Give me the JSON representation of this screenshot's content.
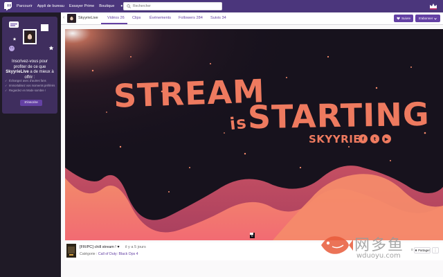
{
  "nav": {
    "items": [
      "Parcourir",
      "Appli de bureau",
      "Essayer Prime",
      "Boutique"
    ],
    "more": "•••",
    "search_placeholder": "Rechercher"
  },
  "sidebar": {
    "promo_line1": "Inscrivez-vous pour profiter de ce que",
    "promo_channel": "SkyyrieLive",
    "promo_line2": "a de mieux à offrir :",
    "benefits": [
      "Échangez avec d'autres fans",
      "Immortalisez vos moments préférés",
      "Regardez en Mode sombre !"
    ],
    "signup_label": "S'inscrire"
  },
  "channel": {
    "name": "SkyyrieLive",
    "tabs": [
      "Vidéos 26",
      "Clips",
      "Événements",
      "Followers 284",
      "Suivis 34"
    ],
    "follow_label": "Suivre",
    "subscribe_label": "S'abonner"
  },
  "player": {
    "line1": "STREAM",
    "line2": "is",
    "line3": "STARTING",
    "brand": "SKYYRIE",
    "social": [
      "f",
      "t",
      "▶"
    ],
    "count": "0"
  },
  "video": {
    "title": "[FR/PC] chill stream ! ♥",
    "time": "il y a 5 jours",
    "category_label": "Catégorie :",
    "category": "Call of Duty: Black Ops 4",
    "views": "0",
    "share_label": "Partager",
    "more": "⋮"
  },
  "watermark": {
    "cn": "网多鱼",
    "url": "wduoyu.com"
  },
  "colors": {
    "brand_purple": "#6441a4",
    "nav_purple": "#4b367c",
    "title_orange": "#ee7a5f"
  }
}
